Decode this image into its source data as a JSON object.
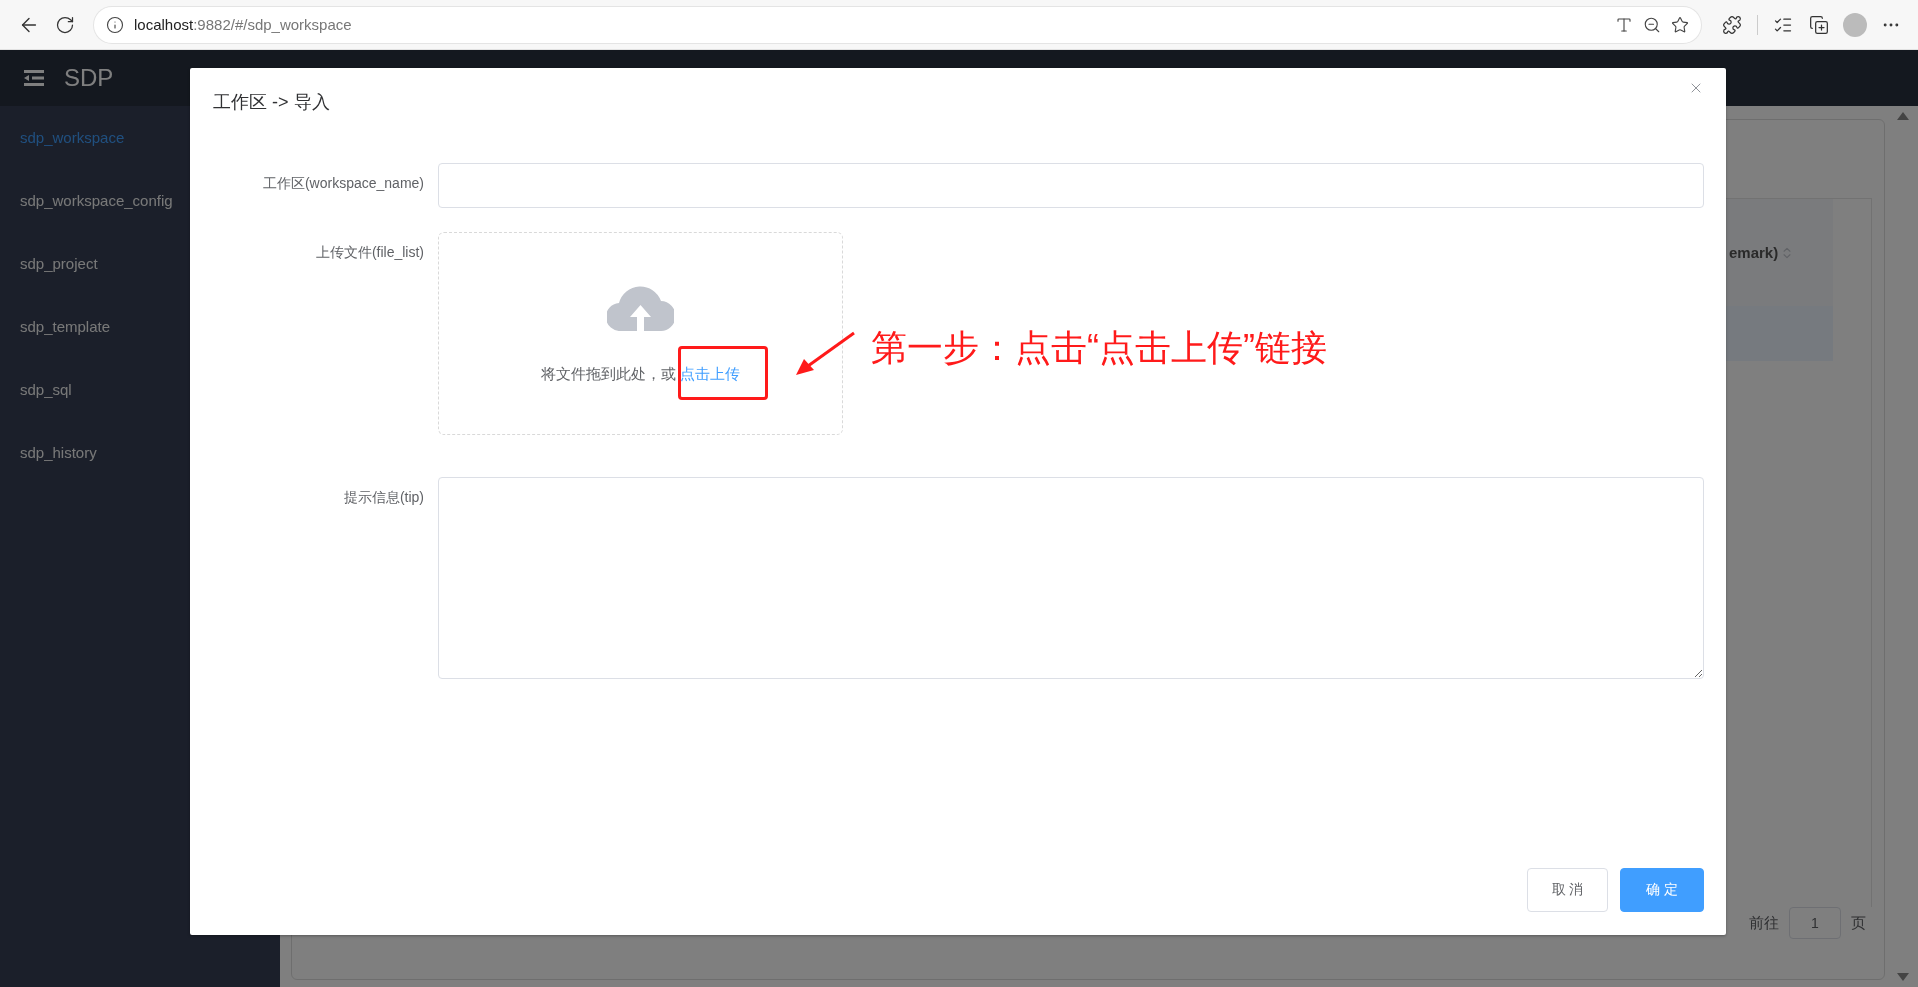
{
  "browser": {
    "url_host": "localhost",
    "url_path": ":9882/#/sdp_workspace"
  },
  "app": {
    "title": "SDP"
  },
  "sidebar": {
    "items": [
      {
        "label": "sdp_workspace",
        "selected": true
      },
      {
        "label": "sdp_workspace_config",
        "selected": false
      },
      {
        "label": "sdp_project",
        "selected": false
      },
      {
        "label": "sdp_template",
        "selected": false
      },
      {
        "label": "sdp_sql",
        "selected": false
      },
      {
        "label": "sdp_history",
        "selected": false
      }
    ]
  },
  "background": {
    "table_header": "emark)",
    "pagination": {
      "goto_label": "前往",
      "page": "1",
      "page_suffix": "页"
    }
  },
  "dialog": {
    "title": "工作区 -> 导入",
    "fields": [
      {
        "kind": "input",
        "label": "工作区(workspace_name)"
      },
      {
        "kind": "upload",
        "label": "上传文件(file_list)",
        "hint": "将文件拖到此处，或",
        "link": "点击上传"
      },
      {
        "kind": "textarea",
        "label": "提示信息(tip)"
      }
    ],
    "buttons": [
      {
        "kind": "default",
        "label": "取 消"
      },
      {
        "kind": "primary",
        "label": "确 定"
      }
    ]
  },
  "annotation": {
    "text": "第一步：点击“点击上传”链接"
  }
}
